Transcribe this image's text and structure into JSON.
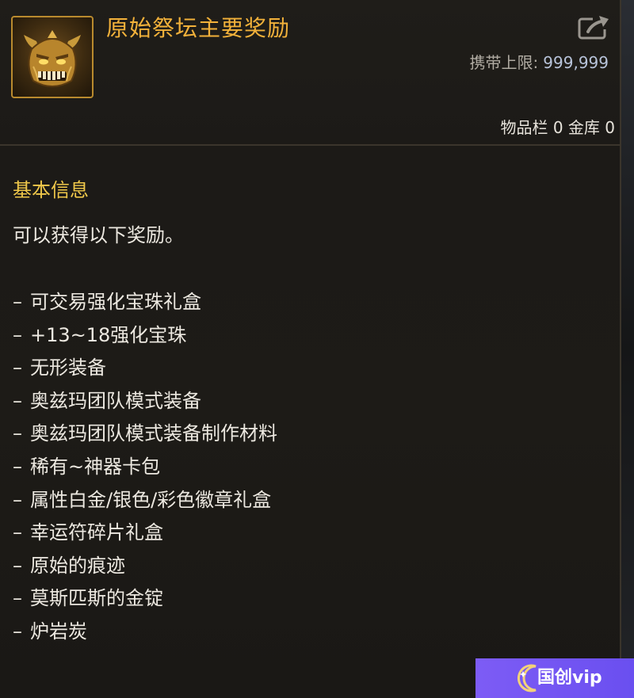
{
  "item": {
    "title": "原始祭坛主要奖励",
    "icon": "golden-demon-mask-icon",
    "carry_limit_label": "携带上限:",
    "carry_limit_value": "999,999",
    "storage_text": "物品栏 0 金库 0"
  },
  "info": {
    "section_title": "基本信息",
    "description": "可以获得以下奖励。",
    "rewards": [
      "可交易强化宝珠礼盒",
      "+13~18强化宝珠",
      "无形装备",
      "奥兹玛团队模式装备",
      "奥兹玛团队模式装备制作材料",
      "稀有~神器卡包",
      "属性白金/银色/彩色徽章礼盒",
      "幸运符碎片礼盒",
      "原始的痕迹",
      "莫斯匹斯的金锭",
      "炉岩炭"
    ],
    "bullet": "–"
  },
  "watermark": {
    "text": "国创vip"
  },
  "colors": {
    "title": "#f2b13a",
    "section": "#f0c84a",
    "body_text": "#ece8e0",
    "limit_value": "#b7c3d9",
    "panel_bg": "#1d1b17",
    "icon_border": "#b98a2e",
    "watermark_bg": "#7d5cf5"
  }
}
